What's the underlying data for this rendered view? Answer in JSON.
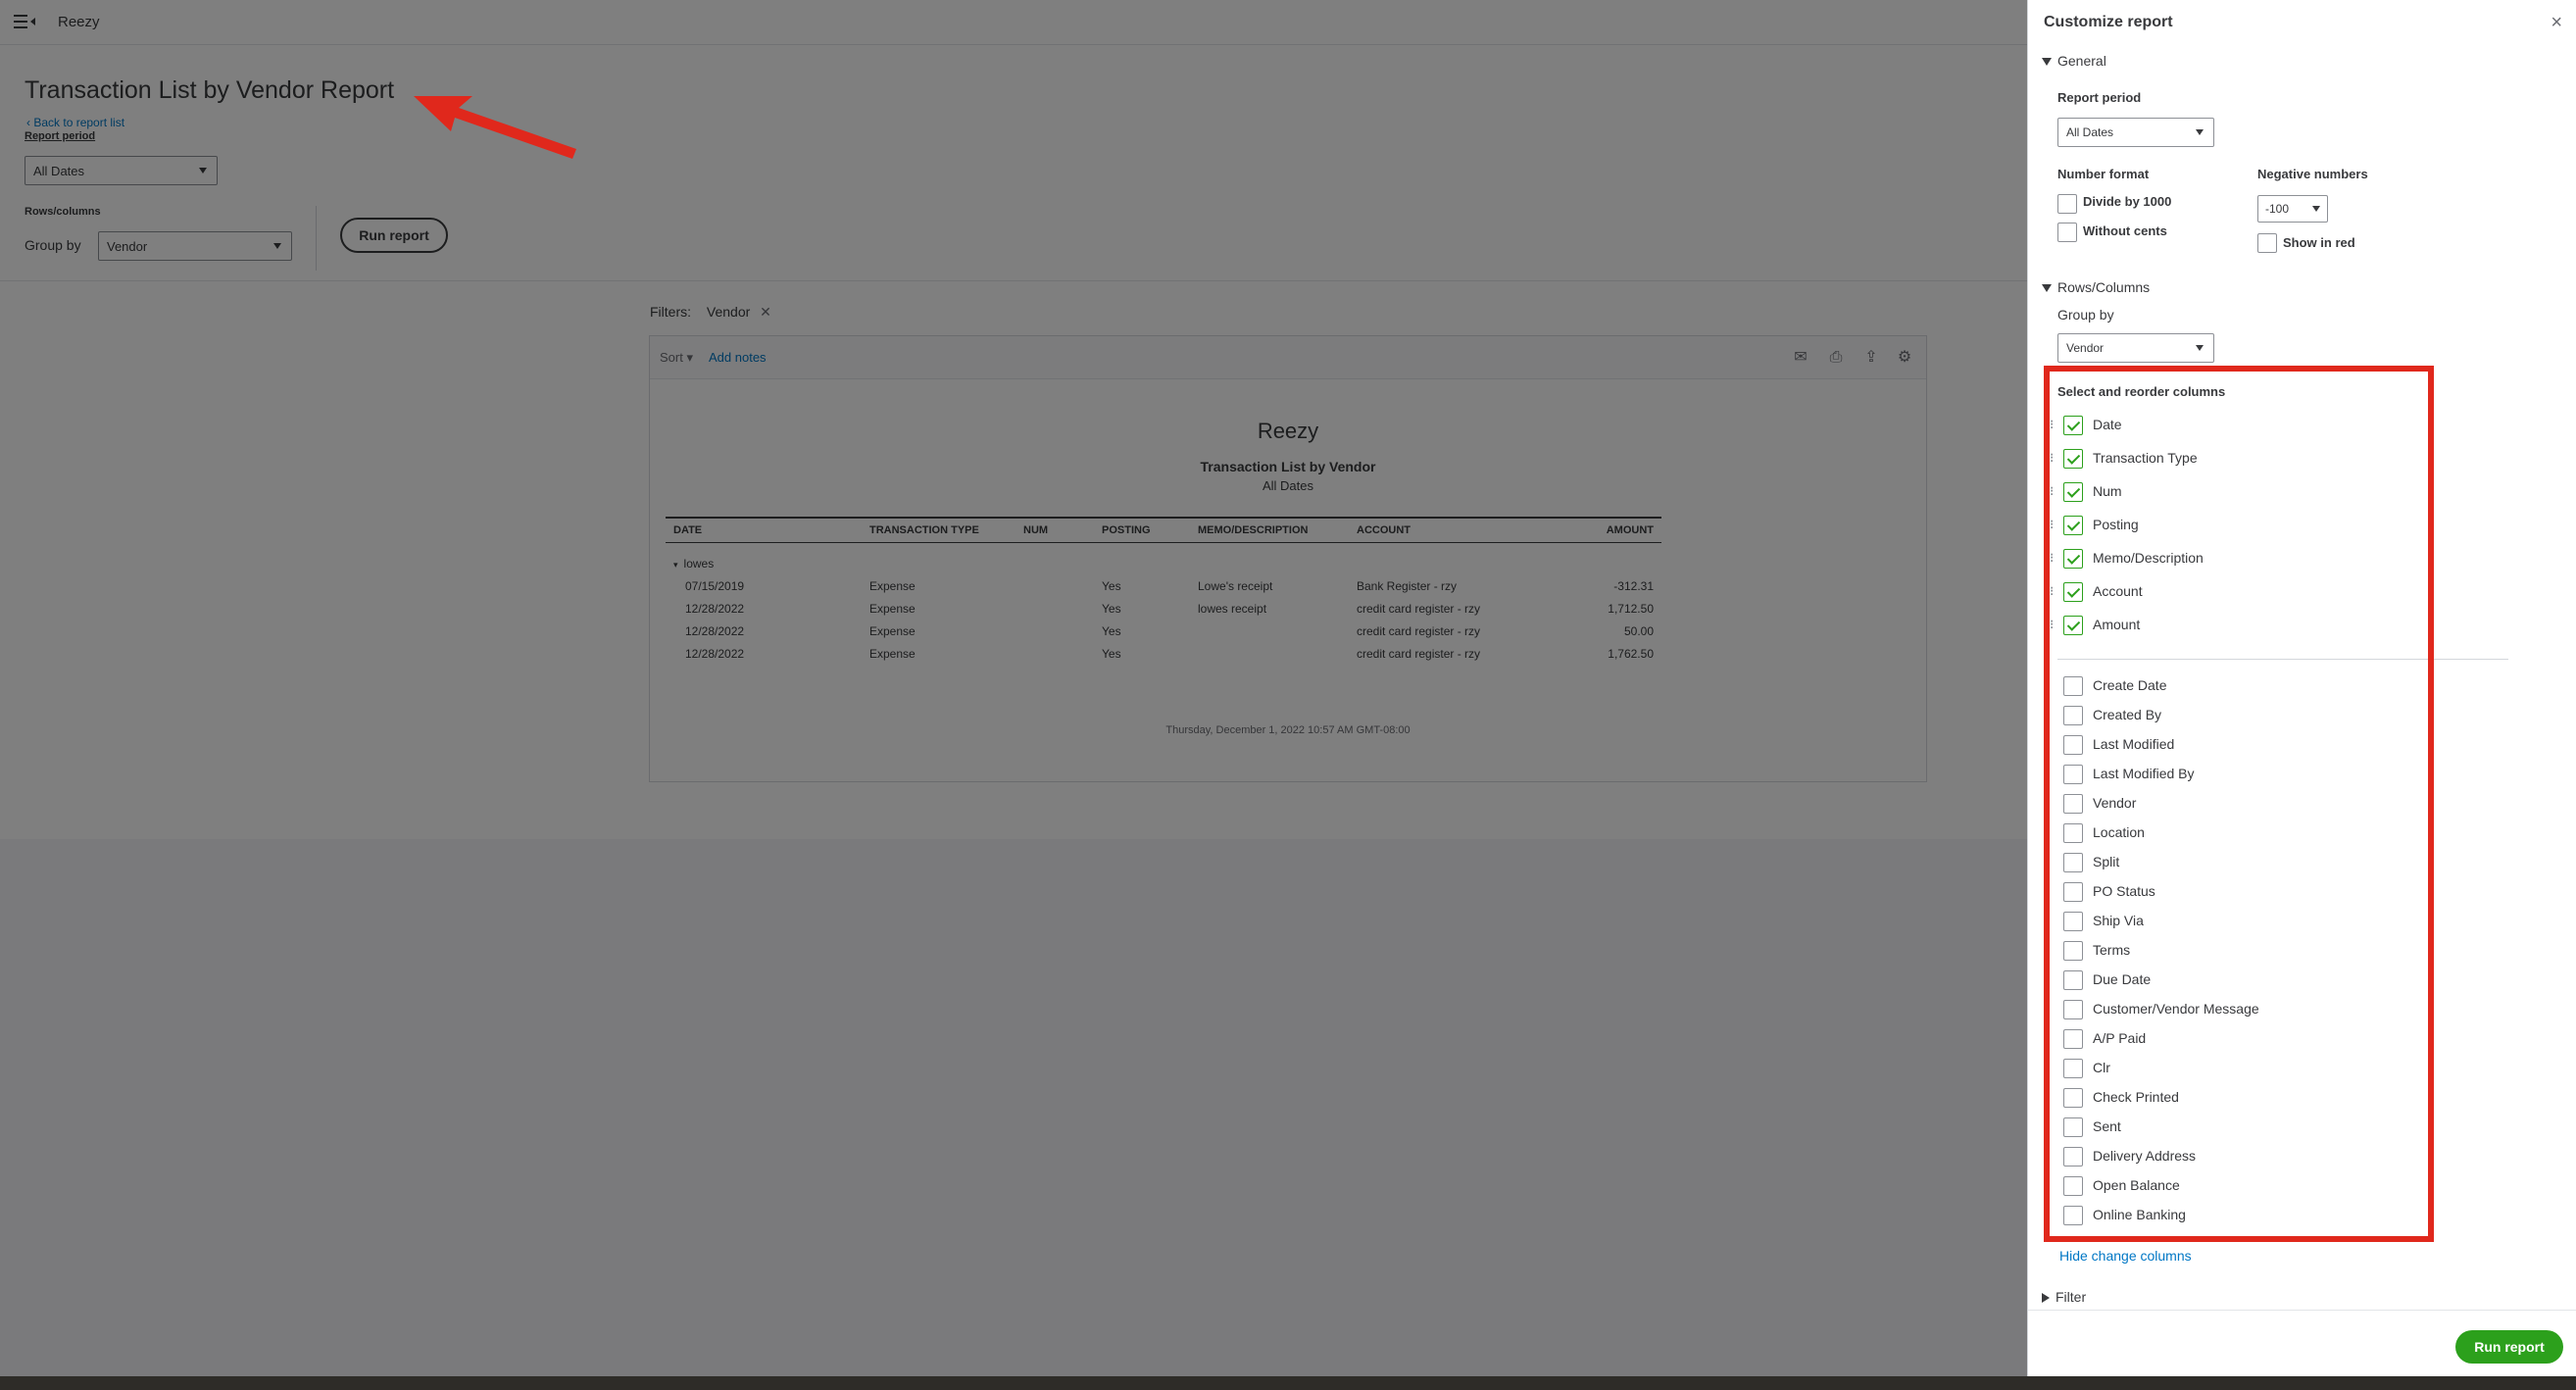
{
  "app": {
    "company": "Reezy"
  },
  "page": {
    "title": "Transaction List by Vendor Report",
    "back_link": "Back to report list",
    "report_period_label": "Report period",
    "report_period_value": "All Dates",
    "rows_columns_label": "Rows/columns",
    "group_by_label": "Group by",
    "group_by_value": "Vendor",
    "run_report_label": "Run report"
  },
  "filters": {
    "label": "Filters:",
    "chip": "Vendor"
  },
  "toolbar": {
    "sort_label": "Sort ▾",
    "add_notes_label": "Add notes"
  },
  "report": {
    "company": "Reezy",
    "title": "Transaction List by Vendor",
    "dates": "All Dates",
    "columns": [
      "DATE",
      "TRANSACTION TYPE",
      "NUM",
      "POSTING",
      "MEMO/DESCRIPTION",
      "ACCOUNT",
      "AMOUNT"
    ],
    "group": "lowes",
    "rows": [
      [
        "07/15/2019",
        "Expense",
        "",
        "Yes",
        "Lowe's receipt",
        "Bank Register - rzy",
        "-312.31"
      ],
      [
        "12/28/2022",
        "Expense",
        "",
        "Yes",
        "lowes receipt",
        "credit card register - rzy",
        "1,712.50"
      ],
      [
        "12/28/2022",
        "Expense",
        "",
        "Yes",
        "",
        "credit card register - rzy",
        "50.00"
      ],
      [
        "12/28/2022",
        "Expense",
        "",
        "Yes",
        "",
        "credit card register - rzy",
        "1,762.50"
      ]
    ],
    "footer": "Thursday, December 1, 2022   10:57 AM GMT-08:00"
  },
  "panel": {
    "title": "Customize report",
    "general_label": "General",
    "report_period_label": "Report period",
    "report_period_value": "All Dates",
    "number_format_label": "Number format",
    "divide_label": "Divide by 1000",
    "without_cents_label": "Without cents",
    "negative_numbers_label": "Negative numbers",
    "negative_value": "-100",
    "show_red_label": "Show in red",
    "rows_columns_label": "Rows/Columns",
    "group_by_label": "Group by",
    "group_by_value": "Vendor",
    "select_columns_label": "Select and reorder columns",
    "selected_columns": [
      "Date",
      "Transaction Type",
      "Num",
      "Posting",
      "Memo/Description",
      "Account",
      "Amount"
    ],
    "other_columns": [
      "Create Date",
      "Created By",
      "Last Modified",
      "Last Modified By",
      "Vendor",
      "Location",
      "Split",
      "PO Status",
      "Ship Via",
      "Terms",
      "Due Date",
      "Customer/Vendor Message",
      "A/P Paid",
      "Clr",
      "Check Printed",
      "Sent",
      "Delivery Address",
      "Open Balance",
      "Online Banking"
    ],
    "hide_link": "Hide change columns",
    "filter_label": "Filter",
    "run_report_label": "Run report"
  },
  "colors": {
    "accent_green": "#2ca01c",
    "link_blue": "#0077c5",
    "annotation_red": "#e0281c"
  }
}
